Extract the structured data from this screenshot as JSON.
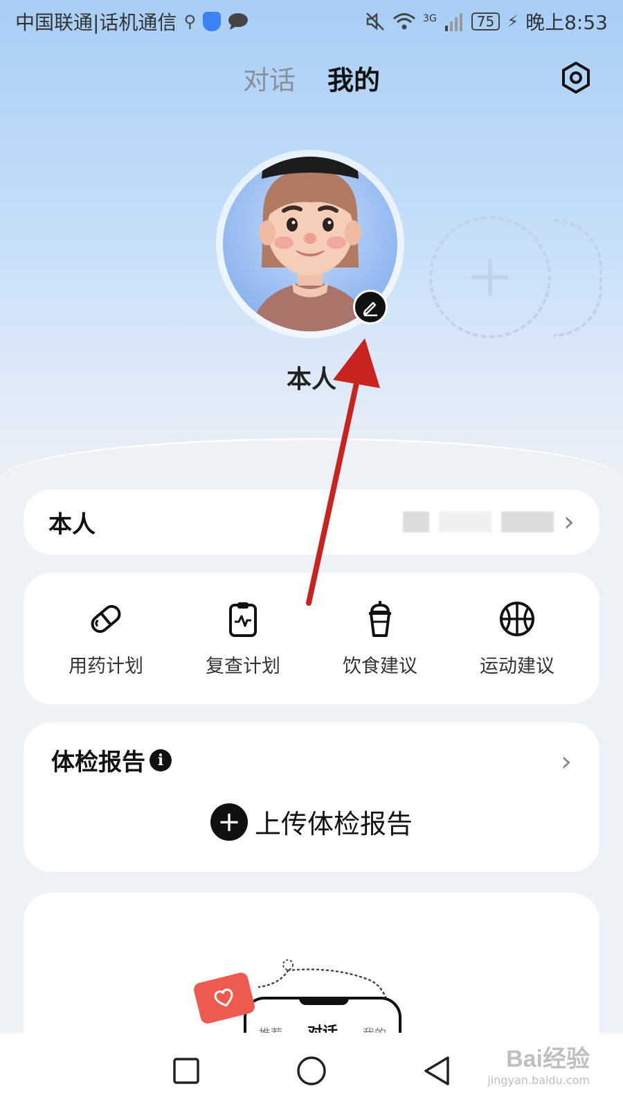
{
  "status_bar": {
    "carrier": "中国联通|话机通信",
    "network": "3G",
    "battery": "75",
    "time": "晚上8:53"
  },
  "top_tabs": [
    {
      "label": "对话",
      "active": false
    },
    {
      "label": "我的",
      "active": true
    }
  ],
  "profile": {
    "name": "本人"
  },
  "person_card": {
    "label": "本人"
  },
  "actions": [
    {
      "label": "用药计划",
      "icon": "pill-icon"
    },
    {
      "label": "复查计划",
      "icon": "clipboard-pulse-icon"
    },
    {
      "label": "饮食建议",
      "icon": "drink-cup-icon"
    },
    {
      "label": "运动建议",
      "icon": "basketball-icon"
    }
  ],
  "report": {
    "title": "体检报告",
    "info": "i",
    "upload_label": "上传体检报告"
  },
  "promo": {
    "tabs": [
      "推荐",
      "对话",
      "我的"
    ]
  },
  "watermark": {
    "main": "Bai经验",
    "sub": "jingyan.baidu.com"
  },
  "colors": {
    "hero_top": "#a8cef6",
    "page_bg": "#eef1f6",
    "annotation_arrow": "#c9231f",
    "promo_heart": "#ee5a4f"
  }
}
